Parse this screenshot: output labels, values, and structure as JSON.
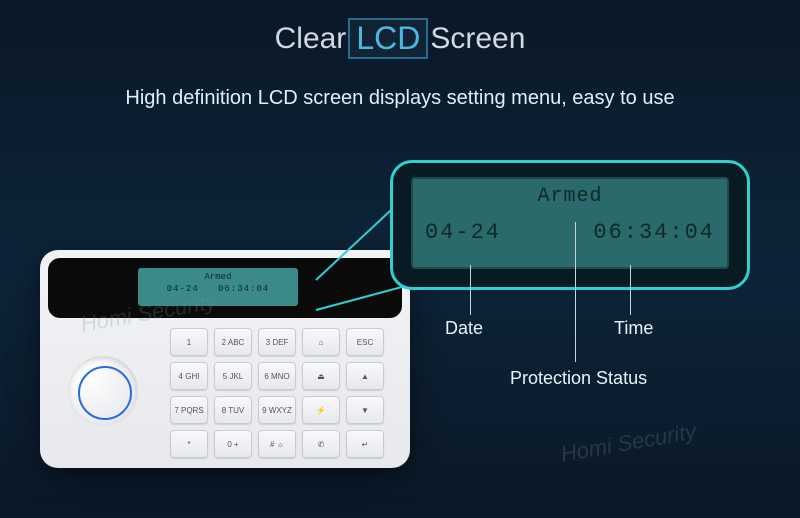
{
  "title": {
    "word1": "Clear",
    "lcd": "LCD",
    "word2": "Screen"
  },
  "subtitle": "High definition LCD screen displays setting menu, easy to use",
  "device_lcd": {
    "status": "Armed",
    "date": "04-24",
    "time": "06:34:04"
  },
  "callout": {
    "status": "Armed",
    "date": "04-24",
    "time": "06:34:04"
  },
  "labels": {
    "date": "Date",
    "time": "Time",
    "status": "Protection Status"
  },
  "keys": [
    "1",
    "2 ABC",
    "3 DEF",
    "⌂",
    "ESC",
    "4 GHI",
    "5 JKL",
    "6 MNO",
    "⏏",
    "▲",
    "7 PQRS",
    "8 TUV",
    "9 WXYZ",
    "⚡",
    "▼",
    "*",
    "0 +",
    "# ☼",
    "✆",
    "↵"
  ],
  "watermark": "Homi Security"
}
